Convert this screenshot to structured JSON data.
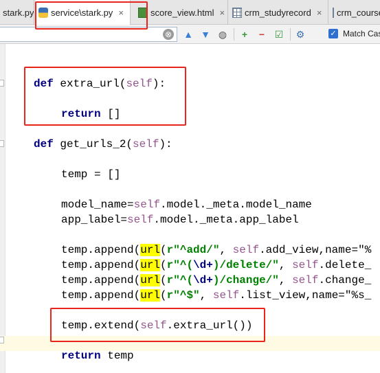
{
  "tabs": [
    {
      "label": "stark.py",
      "icon": "python-file-icon",
      "close": "×"
    },
    {
      "label": "service\\stark.py",
      "icon": "python-file-icon",
      "close": "×"
    },
    {
      "label": "score_view.html",
      "icon": "html-file-icon",
      "close": "×"
    },
    {
      "label": "crm_studyrecord",
      "icon": "table-icon",
      "close": "×"
    },
    {
      "label": "crm_course",
      "icon": "table-icon",
      "close": ""
    }
  ],
  "search": {
    "value": "",
    "clear": "⊗"
  },
  "toolbar": {
    "match_case": "Match Case",
    "match_case_checked": true
  },
  "code": {
    "l1_kw": "def",
    "l1_name": " extra_url(",
    "l1_self": "self",
    "l1_end": "):",
    "l2_kw": "return",
    "l2_rest": " []",
    "l3_kw": "def",
    "l3_name": " get_urls_2(",
    "l3_self": "self",
    "l3_end": "):",
    "l4": "temp = []",
    "l5_a": "model_name=",
    "l5_self": "self",
    "l5_b": ".model._meta.model_name",
    "l6_a": "app_label=",
    "l6_self": "self",
    "l6_b": ".model._meta.app_label",
    "a1_pre": "temp.append(",
    "a1_url": "url",
    "a1_paren": "(",
    "a1_str": "r\"^add/\"",
    "a1_mid": ", ",
    "a1_self": "self",
    "a1_rest": ".add_view,name=\"%",
    "a2_pre": "temp.append(",
    "a2_url": "url",
    "a2_paren": "(",
    "a2_s1": "r\"^(",
    "a2_esc": "\\d+",
    "a2_s2": ")/delete/\"",
    "a2_mid": ", ",
    "a2_self": "self",
    "a2_rest": ".delete_",
    "a3_pre": "temp.append(",
    "a3_url": "url",
    "a3_paren": "(",
    "a3_s1": "r\"^(",
    "a3_esc": "\\d+",
    "a3_s2": ")/change/\"",
    "a3_mid": ", ",
    "a3_self": "self",
    "a3_rest": ".change_",
    "a4_pre": "temp.append(",
    "a4_url": "url",
    "a4_paren": "(",
    "a4_str": "r\"^$\"",
    "a4_mid": ", ",
    "a4_self": "self",
    "a4_rest": ".list_view,name=\"%s_",
    "ext_pre": "temp.extend(",
    "ext_self": "self",
    "ext_rest": ".extra_url())",
    "ret_kw": "return",
    "ret_rest": " temp"
  }
}
